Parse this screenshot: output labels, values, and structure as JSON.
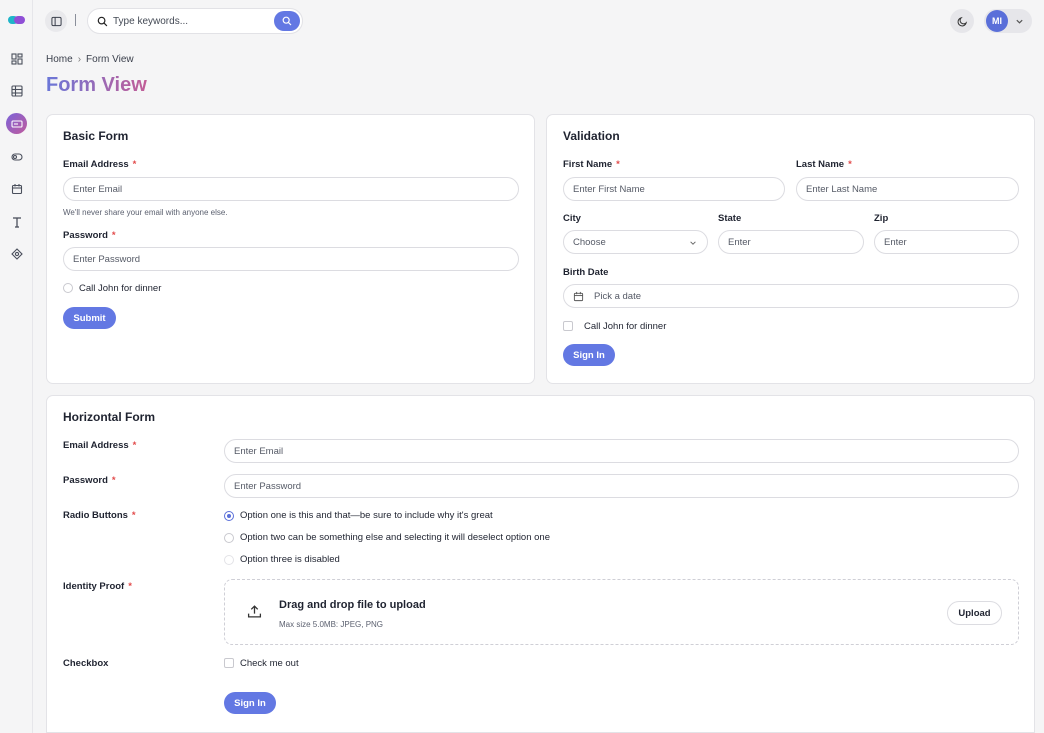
{
  "topbar": {
    "search_placeholder": "Type keywords...",
    "avatar_initials": "MI",
    "accent_color": "#6378e3"
  },
  "sidebar": {
    "items": [
      {
        "icon": "dashboard-icon"
      },
      {
        "icon": "table-icon"
      },
      {
        "icon": "form-icon",
        "active": true
      },
      {
        "icon": "toggle-icon"
      },
      {
        "icon": "calendar-icon"
      },
      {
        "icon": "typography-icon"
      },
      {
        "icon": "components-icon"
      }
    ]
  },
  "breadcrumb": {
    "home": "Home",
    "separator": "›",
    "current": "Form View"
  },
  "page_title": "Form View",
  "basic_form": {
    "title": "Basic Form",
    "email_label": "Email Address",
    "email_placeholder": "Enter Email",
    "email_hint": "We'll never share your email with anyone else.",
    "password_label": "Password",
    "password_placeholder": "Enter Password",
    "radio_label": "Call John for dinner",
    "submit_label": "Submit"
  },
  "validation": {
    "title": "Validation",
    "first_name_label": "First Name",
    "first_name_placeholder": "Enter First Name",
    "last_name_label": "Last Name",
    "last_name_placeholder": "Enter Last Name",
    "city_label": "City",
    "city_value": "Choose",
    "state_label": "State",
    "state_placeholder": "Enter",
    "zip_label": "Zip",
    "zip_placeholder": "Enter",
    "birth_label": "Birth Date",
    "birth_placeholder": "Pick a date",
    "checkbox_label": "Call John for dinner",
    "signin_label": "Sign In"
  },
  "horizontal_form": {
    "title": "Horizontal Form",
    "email_label": "Email Address",
    "email_placeholder": "Enter Email",
    "password_label": "Password",
    "password_placeholder": "Enter Password",
    "radio_label": "Radio Buttons",
    "radio_options": [
      "Option one is this and that—be sure to include why it's great",
      "Option two can be something else and selecting it will deselect option one",
      "Option three is disabled"
    ],
    "identity_label": "Identity Proof",
    "dropzone_title": "Drag and drop file to upload",
    "dropzone_sub": "Max size 5.0MB: JPEG, PNG",
    "upload_label": "Upload",
    "checkbox_section_label": "Checkbox",
    "checkbox_label": "Check me out",
    "signin_label": "Sign In"
  }
}
